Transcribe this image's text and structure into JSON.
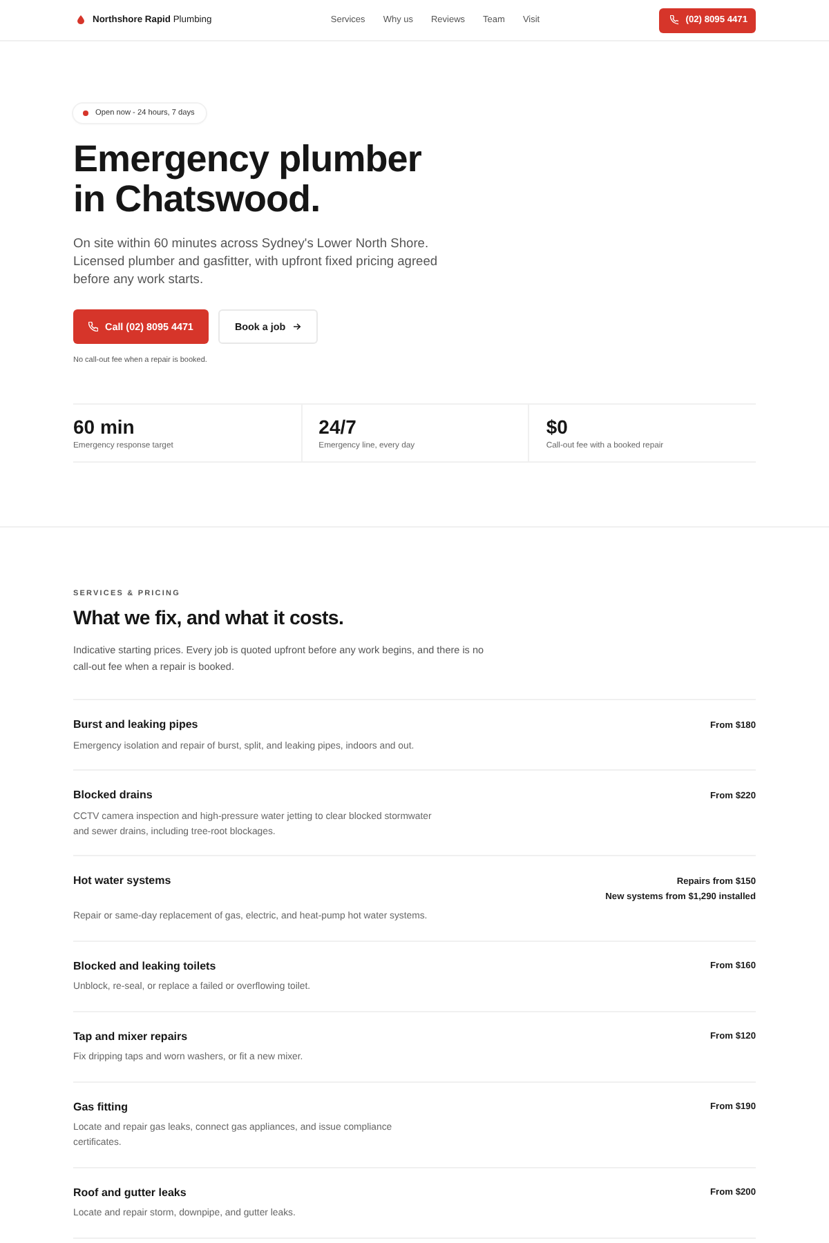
{
  "header": {
    "brand": "**Northshore Rapid** Plumbing",
    "nav": [
      "Services",
      "Why us",
      "Reviews",
      "Team",
      "Visit"
    ],
    "call_button": "(02) 8095 4471"
  },
  "hero": {
    "status_badge": "Open now - 24 hours, 7 days",
    "title": "Emergency plumber in Chatswood.",
    "intro": "On site within 60 minutes across Sydney's Lower North Shore. Licensed plumber and gasfitter, with upfront fixed pricing agreed before any work starts.",
    "buttons": [
      {
        "kind": "call",
        "label": "Call (02) 8095 4471"
      },
      {
        "kind": "book",
        "label": "Book a job"
      }
    ],
    "note": "No call-out fee when a repair is booked."
  },
  "stats": [
    {
      "value": "60 min",
      "label": "Emergency response target"
    },
    {
      "value": "24/7",
      "label": "Emergency line, every day"
    },
    {
      "value": "$0",
      "label": "Call-out fee with a booked repair"
    }
  ],
  "services": {
    "eyebrow": "SERVICES & PRICING",
    "title": "What we fix, and what it costs.",
    "intro": "Indicative starting prices. Every job is quoted upfront before any work begins, and there is no call-out fee when a repair is booked.",
    "items": [
      {
        "name": "Burst and leaking pipes",
        "description": "Emergency isolation and repair of burst, split, and leaking pipes, indoors and out.",
        "prices": [
          "From $180"
        ]
      },
      {
        "name": "Blocked drains",
        "description": "CCTV camera inspection and high-pressure water jetting to clear blocked stormwater and sewer drains, including tree-root blockages.",
        "prices": [
          "From $220"
        ]
      },
      {
        "name": "Hot water systems",
        "description": "Repair or same-day replacement of gas, electric, and heat-pump hot water systems.",
        "prices": [
          "Repairs from $150",
          "New systems from $1,290 installed"
        ]
      },
      {
        "name": "Blocked and leaking toilets",
        "description": "Unblock, re-seal, or replace a failed or overflowing toilet.",
        "prices": [
          "From $160"
        ]
      },
      {
        "name": "Tap and mixer repairs",
        "description": "Fix dripping taps and worn washers, or fit a new mixer.",
        "prices": [
          "From $120"
        ]
      },
      {
        "name": "Gas fitting",
        "description": "Locate and repair gas leaks, connect gas appliances, and issue compliance certificates.",
        "prices": [
          "From $190"
        ]
      },
      {
        "name": "Roof and gutter leaks",
        "description": "Locate and repair storm, downpipe, and gutter leaks.",
        "prices": [
          "From $200"
        ]
      }
    ]
  }
}
